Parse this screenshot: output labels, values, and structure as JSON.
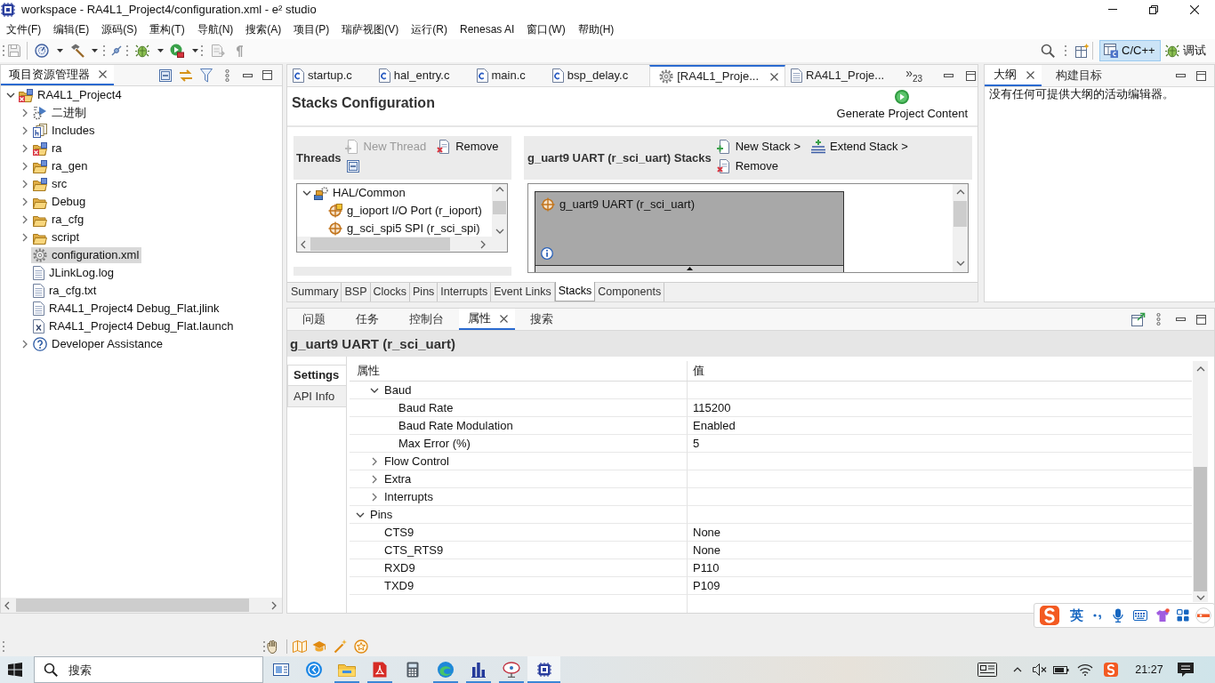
{
  "window": {
    "title": "workspace - RA4L1_Project4/configuration.xml - e² studio"
  },
  "menu": [
    "文件(F)",
    "编辑(E)",
    "源码(S)",
    "重构(T)",
    "导航(N)",
    "搜索(A)",
    "项目(P)",
    "瑞萨视图(V)",
    "运行(R)",
    "Renesas AI",
    "窗口(W)",
    "帮助(H)"
  ],
  "perspectives": [
    {
      "label": "C/C++",
      "kind": "cpp",
      "selected": true
    },
    {
      "label": "调试",
      "kind": "debug",
      "selected": false
    }
  ],
  "project_explorer": {
    "tab": "项目资源管理器",
    "tree": [
      {
        "label": "RA4L1_Project4",
        "kind": "project",
        "expanded": true,
        "selected": false,
        "children": [
          {
            "label": "二进制",
            "kind": "binaries",
            "expanded": false,
            "selected": false
          },
          {
            "label": "Includes",
            "kind": "includes",
            "expanded": false,
            "selected": false
          },
          {
            "label": "ra",
            "kind": "source-folder-error",
            "expanded": false,
            "selected": false
          },
          {
            "label": "ra_gen",
            "kind": "source-folder",
            "expanded": false,
            "selected": false
          },
          {
            "label": "src",
            "kind": "source-folder",
            "expanded": false,
            "selected": false
          },
          {
            "label": "Debug",
            "kind": "folder",
            "expanded": false,
            "selected": false
          },
          {
            "label": "ra_cfg",
            "kind": "folder",
            "expanded": false,
            "selected": false
          },
          {
            "label": "script",
            "kind": "folder",
            "expanded": false,
            "selected": false
          },
          {
            "label": "configuration.xml",
            "kind": "config-file",
            "selected": true
          },
          {
            "label": "JLinkLog.log",
            "kind": "text-file",
            "selected": false
          },
          {
            "label": "ra_cfg.txt",
            "kind": "text-file",
            "selected": false
          },
          {
            "label": "RA4L1_Project4 Debug_Flat.jlink",
            "kind": "text-file",
            "selected": false
          },
          {
            "label": "RA4L1_Project4 Debug_Flat.launch",
            "kind": "launch-file",
            "selected": false
          },
          {
            "label": "Developer Assistance",
            "kind": "help",
            "expanded": false,
            "selected": false
          }
        ]
      }
    ]
  },
  "editor": {
    "tabs": [
      {
        "label": "startup.c",
        "kind": "c-file",
        "selected": false
      },
      {
        "label": "hal_entry.c",
        "kind": "c-file",
        "selected": false
      },
      {
        "label": "main.c",
        "kind": "c-file",
        "selected": false
      },
      {
        "label": "bsp_delay.c",
        "kind": "c-file",
        "selected": false
      },
      {
        "label": "[RA4L1_Proje...",
        "kind": "config",
        "selected": true
      },
      {
        "label": "RA4L1_Proje...",
        "kind": "text-file",
        "selected": false
      }
    ],
    "overflow": {
      "glyph": "»",
      "count": "23"
    },
    "title": "Stacks Configuration",
    "generate": "Generate Project Content",
    "threads": {
      "title": "Threads",
      "actions": [
        {
          "label": "New Thread",
          "kind": "new",
          "disabled": true
        },
        {
          "label": "Remove",
          "kind": "remove",
          "disabled": false
        }
      ],
      "tree": [
        {
          "label": "HAL/Common",
          "kind": "hal",
          "expanded": true,
          "selected": false,
          "children": [
            {
              "label": "g_ioport I/O Port (r_ioport)",
              "kind": "module-flagged",
              "selected": false
            },
            {
              "label": "g_sci_spi5 SPI (r_sci_spi)",
              "kind": "module",
              "selected": false
            }
          ]
        }
      ]
    },
    "stacks": {
      "title": "g_uart9 UART (r_sci_uart) Stacks",
      "actions": [
        {
          "label": "New Stack >",
          "kind": "new"
        },
        {
          "label": "Extend Stack >",
          "kind": "extend"
        },
        {
          "label": "Remove",
          "kind": "remove"
        }
      ],
      "blocks": [
        {
          "label": "g_uart9 UART (r_sci_uart)"
        }
      ]
    },
    "pages": [
      {
        "label": "Summary",
        "selected": false
      },
      {
        "label": "BSP",
        "selected": false
      },
      {
        "label": "Clocks",
        "selected": false
      },
      {
        "label": "Pins",
        "selected": false
      },
      {
        "label": "Interrupts",
        "selected": false
      },
      {
        "label": "Event Links",
        "selected": false
      },
      {
        "label": "Stacks",
        "selected": true
      },
      {
        "label": "Components",
        "selected": false
      }
    ]
  },
  "outline": {
    "tabs": [
      {
        "label": "大纲",
        "selected": true
      },
      {
        "label": "构建目标",
        "selected": false
      }
    ],
    "message": "没有任何可提供大纲的活动编辑器。"
  },
  "properties": {
    "tabs": [
      {
        "label": "问题",
        "selected": false
      },
      {
        "label": "任务",
        "selected": false
      },
      {
        "label": "控制台",
        "selected": false
      },
      {
        "label": "属性",
        "selected": true
      },
      {
        "label": "搜索",
        "selected": false
      }
    ],
    "title": "g_uart9 UART (r_sci_uart)",
    "sections": [
      {
        "label": "Settings",
        "selected": true
      },
      {
        "label": "API Info",
        "selected": false
      }
    ],
    "table": {
      "columns": [
        "属性",
        "值"
      ],
      "rows": [
        {
          "children": [
            {
              "label": "Baud",
              "expanded": true,
              "children": [
                {
                  "label": "Baud Rate",
                  "value": "115200"
                },
                {
                  "label": "Baud Rate Modulation",
                  "value": "Enabled"
                },
                {
                  "label": "Max Error (%)",
                  "value": "5"
                }
              ]
            },
            {
              "label": "Flow Control",
              "expanded": false
            },
            {
              "label": "Extra",
              "expanded": false
            },
            {
              "label": "Interrupts",
              "expanded": false
            }
          ]
        },
        {
          "label": "Pins",
          "expanded": true,
          "children": [
            {
              "label": "CTS9",
              "value": "None"
            },
            {
              "label": "CTS_RTS9",
              "value": "None"
            },
            {
              "label": "RXD9",
              "value": "P110"
            },
            {
              "label": "TXD9",
              "value": "P109"
            }
          ]
        }
      ]
    }
  },
  "ime": {
    "mode": "英"
  },
  "taskbar": {
    "search": {
      "placeholder": "搜索"
    },
    "apps": [
      {
        "kind": "window",
        "running": false,
        "selected": false
      },
      {
        "kind": "circle-logo",
        "running": false,
        "selected": false
      },
      {
        "kind": "folder",
        "running": true,
        "selected": false
      },
      {
        "kind": "document-logo",
        "running": true,
        "selected": false
      },
      {
        "kind": "calculator",
        "running": false,
        "selected": false
      },
      {
        "kind": "swirl",
        "running": true,
        "selected": false
      },
      {
        "kind": "bars",
        "running": true,
        "selected": false
      },
      {
        "kind": "dish",
        "running": true,
        "selected": false
      },
      {
        "kind": "chip",
        "running": true,
        "selected": true
      }
    ],
    "clock": "21:27"
  }
}
